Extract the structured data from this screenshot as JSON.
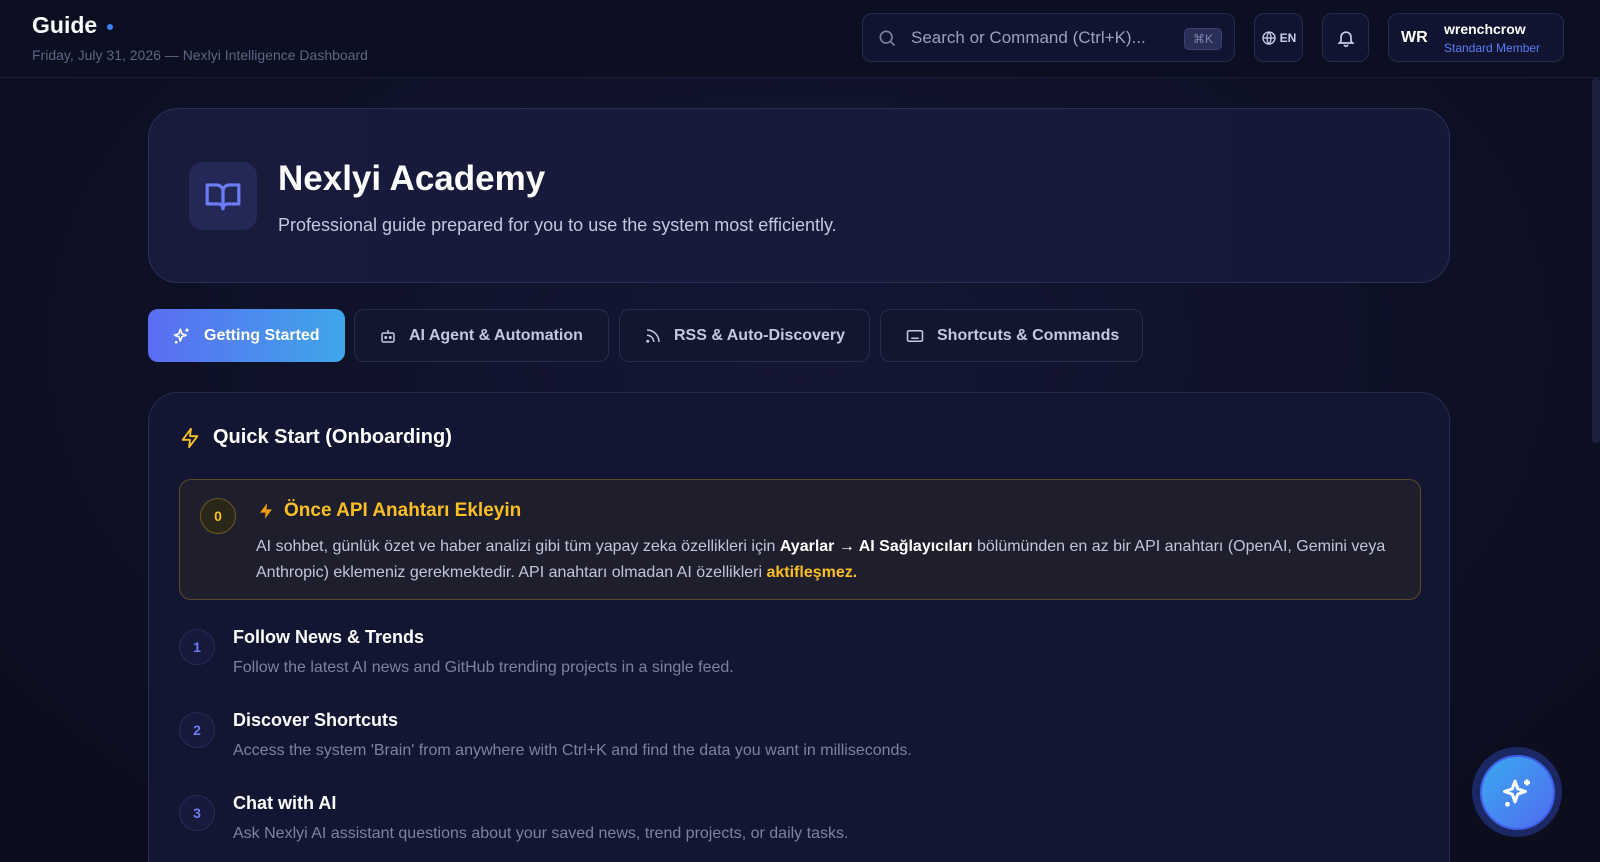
{
  "header": {
    "title": "Guide",
    "subtitle": "Friday, July 31, 2026 — Nexlyi Intelligence Dashboard",
    "search_placeholder": "Search or Command (Ctrl+K)...",
    "search_shortcut": "⌘K",
    "language": "EN",
    "user": {
      "initials": "WR",
      "name": "wrenchcrow",
      "role": "Standard Member"
    }
  },
  "hero": {
    "title": "Nexlyi Academy",
    "subtitle": "Professional guide prepared for you to use the system most efficiently.",
    "icon": "open-book-icon"
  },
  "tabs": [
    {
      "label": "Getting Started",
      "icon": "sparkles-icon",
      "active": true
    },
    {
      "label": "AI Agent & Automation",
      "icon": "robot-icon",
      "active": false
    },
    {
      "label": "RSS & Auto-Discovery",
      "icon": "rss-icon",
      "active": false
    },
    {
      "label": "Shortcuts & Commands",
      "icon": "keyboard-icon",
      "active": false
    }
  ],
  "section": {
    "title": "Quick Start (Onboarding)",
    "notice": {
      "number": "0",
      "title": "Önce API Anahtarı Ekleyin",
      "body_1": "AI sohbet, günlük özet ve haber analizi gibi tüm yapay zeka özellikleri için ",
      "body_bold": "Ayarlar → AI Sağlayıcıları",
      "body_2": " bölümünden en az bir API anahtarı (OpenAI, Gemini veya Anthropic) eklemeniz gerekmektedir. API anahtarı olmadan AI özellikleri ",
      "body_highlight": "aktifleşmez."
    },
    "steps": [
      {
        "number": "1",
        "title": "Follow News & Trends",
        "description": "Follow the latest AI news and GitHub trending projects in a single feed."
      },
      {
        "number": "2",
        "title": "Discover Shortcuts",
        "description": "Access the system 'Brain' from anywhere with Ctrl+K and find the data you want in milliseconds."
      },
      {
        "number": "3",
        "title": "Chat with AI",
        "description": "Ask Nexlyi AI assistant questions about your saved news, trend projects, or daily tasks."
      }
    ]
  },
  "colors": {
    "accent": "#5b6cf2",
    "accent_secondary": "#3fa6ea",
    "warning": "#fbbf24",
    "background": "#0e1126"
  }
}
